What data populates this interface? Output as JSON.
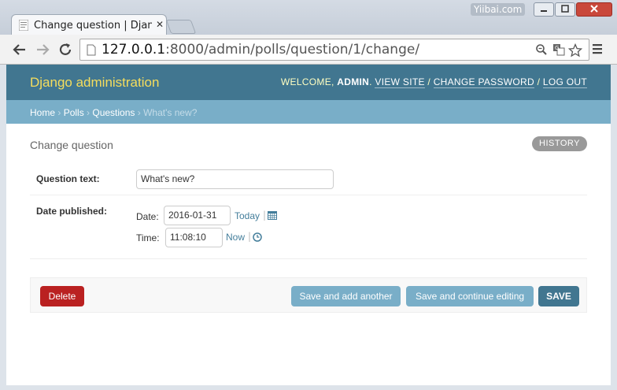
{
  "browser": {
    "tab_title": "Change question | Djang",
    "watermark": "Yiibai.com",
    "url_host": "127.0.0.1",
    "url_rest": ":8000/admin/polls/question/1/change/"
  },
  "header": {
    "brand": "Django administration",
    "welcome": "WELCOME,",
    "username": "ADMIN",
    "view_site": "VIEW SITE",
    "change_password": "CHANGE PASSWORD",
    "logout": "LOG OUT"
  },
  "breadcrumbs": {
    "home": "Home",
    "polls": "Polls",
    "questions": "Questions",
    "current": "What's new?"
  },
  "page": {
    "title": "Change question",
    "history": "HISTORY"
  },
  "form": {
    "question_label": "Question text:",
    "question_value": "What's new?",
    "date_published_label": "Date published:",
    "date_label": "Date:",
    "date_value": "2016-01-31",
    "today": "Today",
    "time_label": "Time:",
    "time_value": "11:08:10",
    "now": "Now"
  },
  "actions": {
    "delete": "Delete",
    "save_add_another": "Save and add another",
    "save_continue": "Save and continue editing",
    "save": "SAVE"
  },
  "colors": {
    "header_bg": "#417690",
    "breadcrumbs_bg": "#79aec8",
    "brand": "#f5dd5d",
    "delete": "#ba2121",
    "link": "#447e9b"
  },
  "icons": [
    "django-favicon",
    "back-arrow",
    "forward-arrow",
    "reload",
    "page",
    "zoom",
    "translate",
    "star",
    "menu",
    "calendar",
    "clock"
  ]
}
